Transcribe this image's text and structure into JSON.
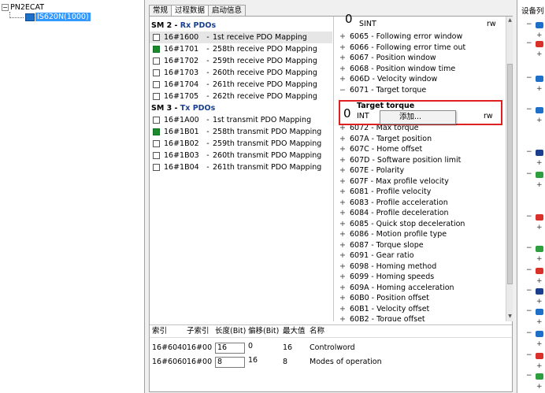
{
  "tree": {
    "root_label": "PN2ECAT",
    "root_toggle": "−",
    "device_label": "IS620N(1000)"
  },
  "tabs": [
    {
      "label": "常规"
    },
    {
      "label": "过程数据"
    },
    {
      "label": "启动信息"
    }
  ],
  "sm2": {
    "title_prefix": "SM 2 - ",
    "title_name": "Rx PDOs",
    "items": [
      {
        "index": "16#1600",
        "sep": "-",
        "name": "1st receive PDO Mapping",
        "checked": false
      },
      {
        "index": "16#1701",
        "sep": "-",
        "name": "258th receive PDO Mapping",
        "checked": true
      },
      {
        "index": "16#1702",
        "sep": "-",
        "name": "259th receive PDO Mapping",
        "checked": false
      },
      {
        "index": "16#1703",
        "sep": "-",
        "name": "260th receive PDO Mapping",
        "checked": false
      },
      {
        "index": "16#1704",
        "sep": "-",
        "name": "261th receive PDO Mapping",
        "checked": false
      },
      {
        "index": "16#1705",
        "sep": "-",
        "name": "262th receive PDO Mapping",
        "checked": false
      }
    ]
  },
  "sm3": {
    "title_prefix": "SM 3 - ",
    "title_name": "Tx PDOs",
    "items": [
      {
        "index": "16#1A00",
        "sep": "-",
        "name": "1st transmit PDO Mapping",
        "checked": false
      },
      {
        "index": "16#1B01",
        "sep": "-",
        "name": "258th transmit PDO Mapping",
        "checked": true
      },
      {
        "index": "16#1B02",
        "sep": "-",
        "name": "259th transmit PDO Mapping",
        "checked": false
      },
      {
        "index": "16#1B03",
        "sep": "-",
        "name": "260th transmit PDO Mapping",
        "checked": false
      },
      {
        "index": "16#1B04",
        "sep": "-",
        "name": "261th transmit PDO Mapping",
        "checked": false
      }
    ]
  },
  "objects": {
    "sint_digit": "0",
    "sint_type": "SINT",
    "sint_access": "rw",
    "top_rows": [
      {
        "pm": "+",
        "text": "6065 - Following error window"
      },
      {
        "pm": "+",
        "text": "6066 - Following error time out"
      },
      {
        "pm": "+",
        "text": "6067 - Position window"
      },
      {
        "pm": "+",
        "text": "6068 - Position window time"
      },
      {
        "pm": "+",
        "text": "606D - Velocity window"
      },
      {
        "pm": "−",
        "text": "6071 - Target torque"
      }
    ],
    "target_torque": {
      "digit": "0",
      "name": "Target torque",
      "type": "INT",
      "access": "rw"
    },
    "menu_add": "添加...",
    "bottom_rows": [
      {
        "pm": "+",
        "text": "6072 - Max torque"
      },
      {
        "pm": "+",
        "text": "607A - Target position"
      },
      {
        "pm": "+",
        "text": "607C - Home offset"
      },
      {
        "pm": "+",
        "text": "607D - Software position limit"
      },
      {
        "pm": "+",
        "text": "607E - Polarity"
      },
      {
        "pm": "+",
        "text": "607F - Max profile velocity"
      },
      {
        "pm": "+",
        "text": "6081 - Profile velocity"
      },
      {
        "pm": "+",
        "text": "6083 - Profile acceleration"
      },
      {
        "pm": "+",
        "text": "6084 - Profile deceleration"
      },
      {
        "pm": "+",
        "text": "6085 - Quick stop deceleration"
      },
      {
        "pm": "+",
        "text": "6086 - Motion profile type"
      },
      {
        "pm": "+",
        "text": "6087 - Torque slope"
      },
      {
        "pm": "+",
        "text": "6091 - Gear ratio"
      },
      {
        "pm": "+",
        "text": "6098 - Homing method"
      },
      {
        "pm": "+",
        "text": "6099 - Homing speeds"
      },
      {
        "pm": "+",
        "text": "609A - Homing acceleration"
      },
      {
        "pm": "+",
        "text": "60B0 - Position offset"
      },
      {
        "pm": "+",
        "text": "60B1 - Velocity offset"
      },
      {
        "pm": "+",
        "text": "60B2 - Torque offset"
      }
    ]
  },
  "mapping": {
    "headers": [
      "索引",
      "子索引",
      "长度(Bit)",
      "偏移(Bit)",
      "最大值",
      "名称"
    ],
    "rows": [
      {
        "index": "16#6040",
        "sub": "16#00",
        "length": "16",
        "offset": "0",
        "max": "16",
        "name": "Controlword"
      },
      {
        "index": "16#6060",
        "sub": "16#00",
        "length": "8",
        "offset": "16",
        "max": "8",
        "name": "Modes of operation"
      }
    ]
  },
  "right_panel": {
    "title": "设备列",
    "colors": {
      "blue": "#1e6fc8",
      "green": "#2e9e3e",
      "red": "#d9302a",
      "navy": "#1b3f8f"
    }
  }
}
